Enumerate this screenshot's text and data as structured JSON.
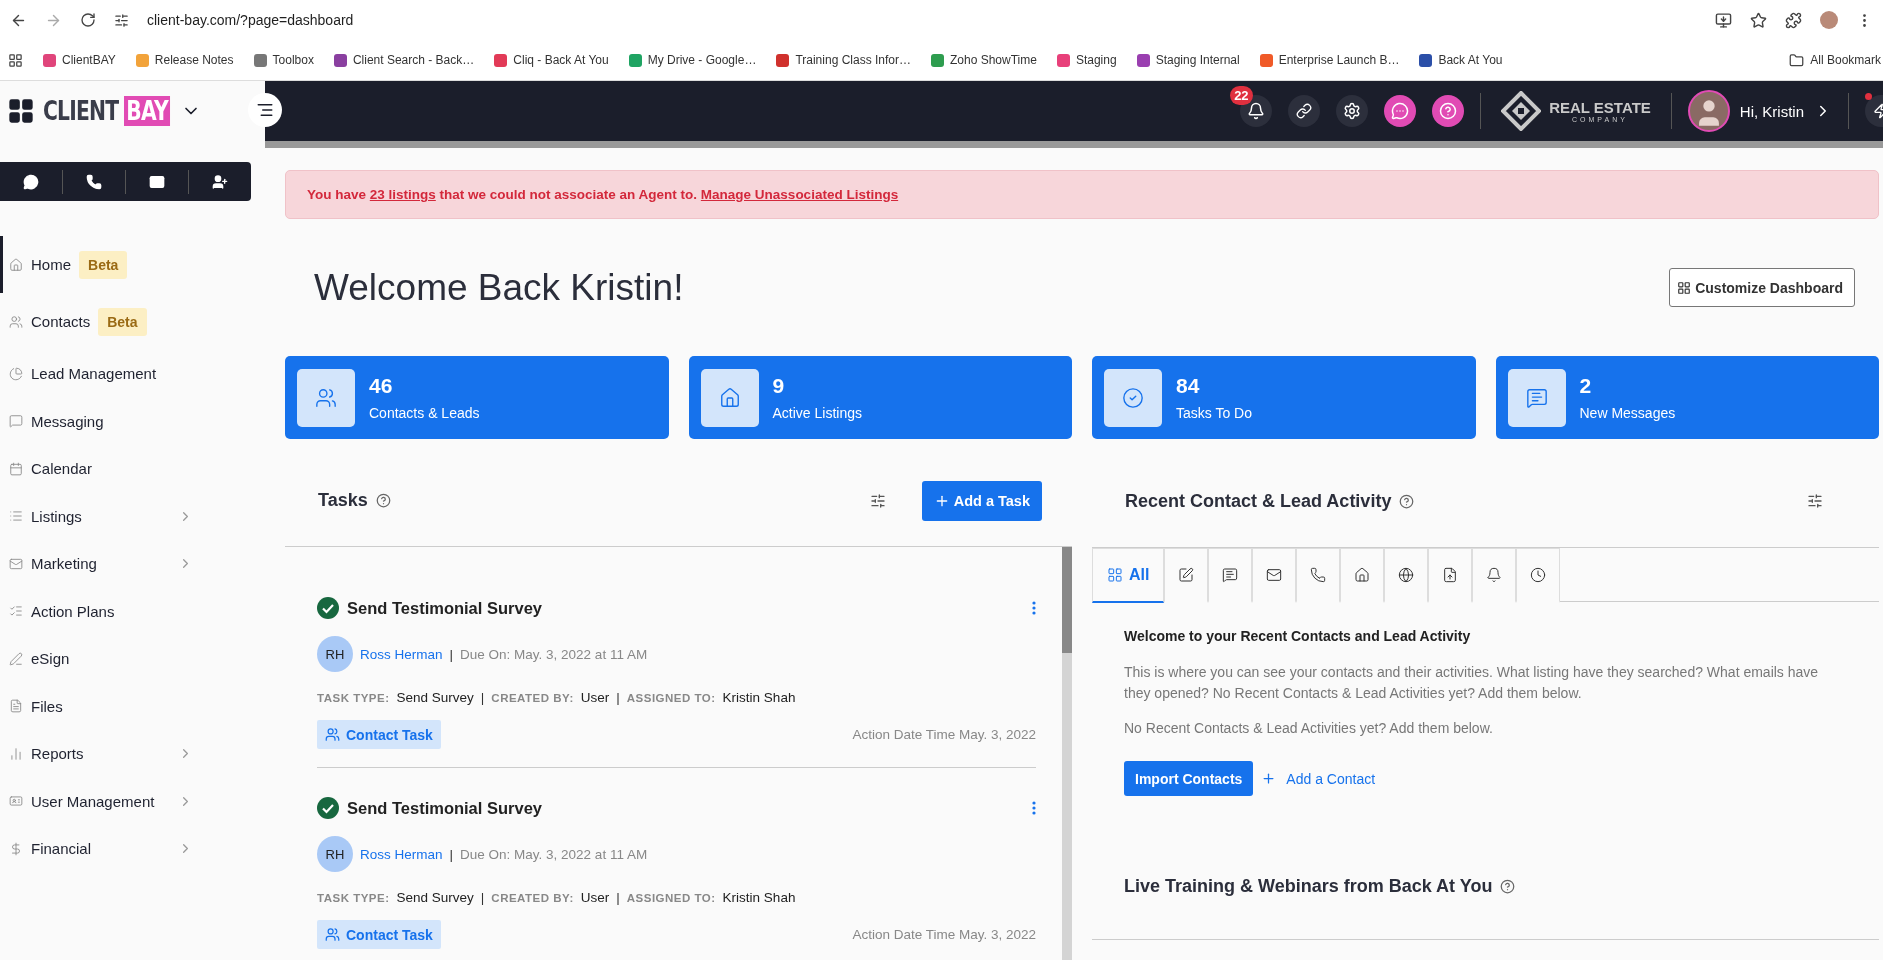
{
  "browser": {
    "url": "client-bay.com/?page=dashboard",
    "all_bookmarks": "All Bookmark",
    "bookmarks": [
      {
        "label": "ClientBAY",
        "color": "#e0457b"
      },
      {
        "label": "Release Notes",
        "color": "#f2a33a"
      },
      {
        "label": "Toolbox",
        "color": "#777777"
      },
      {
        "label": "Client Search - Back…",
        "color": "#8a3fa0"
      },
      {
        "label": "Cliq - Back At You",
        "color": "#e23a57"
      },
      {
        "label": "My Drive - Google…",
        "color": "#1fa463"
      },
      {
        "label": "Training Class Infor…",
        "color": "#d0312d"
      },
      {
        "label": "Zoho ShowTime",
        "color": "#2e9d4f"
      },
      {
        "label": "Staging",
        "color": "#e8407a"
      },
      {
        "label": "Staging Internal",
        "color": "#9a3fb0"
      },
      {
        "label": "Enterprise Launch B…",
        "color": "#f05a28"
      },
      {
        "label": "Back At You",
        "color": "#2b4fa8"
      }
    ]
  },
  "sidebar": {
    "logo_left": "CLIENT",
    "logo_right": "BAY",
    "items": [
      {
        "label": "Home",
        "badge": "Beta",
        "selected": true,
        "has_submenu": false
      },
      {
        "label": "Contacts",
        "badge": "Beta",
        "selected": false,
        "has_submenu": false
      },
      {
        "label": "Lead Management",
        "selected": false,
        "has_submenu": false
      },
      {
        "label": "Messaging",
        "selected": false,
        "has_submenu": false
      },
      {
        "label": "Calendar",
        "selected": false,
        "has_submenu": false
      },
      {
        "label": "Listings",
        "selected": false,
        "has_submenu": true
      },
      {
        "label": "Marketing",
        "selected": false,
        "has_submenu": true
      },
      {
        "label": "Action Plans",
        "selected": false,
        "has_submenu": false
      },
      {
        "label": "eSign",
        "selected": false,
        "has_submenu": false
      },
      {
        "label": "Files",
        "selected": false,
        "has_submenu": false
      },
      {
        "label": "Reports",
        "selected": false,
        "has_submenu": true
      },
      {
        "label": "User Management",
        "selected": false,
        "has_submenu": true
      },
      {
        "label": "Financial",
        "selected": false,
        "has_submenu": true
      }
    ]
  },
  "header": {
    "notification_count": "22",
    "brand_name": "REAL ESTATE",
    "brand_sub": "COMPANY",
    "greeting": "Hi, Kristin"
  },
  "alert": {
    "parts": [
      {
        "kind": "text",
        "text": "You have "
      },
      {
        "kind": "link",
        "text": "23 listings"
      },
      {
        "kind": "text",
        "text": " that we could not associate an Agent to. "
      },
      {
        "kind": "link",
        "text": "Manage Unassociated Listings"
      }
    ]
  },
  "welcome": {
    "title": "Welcome Back Kristin!",
    "customize_button": "Customize Dashboard"
  },
  "stats": [
    {
      "kind": "contacts",
      "value": "46",
      "label": "Contacts & Leads"
    },
    {
      "kind": "listings",
      "value": "9",
      "label": "Active Listings"
    },
    {
      "kind": "tasks",
      "value": "84",
      "label": "Tasks To Do"
    },
    {
      "kind": "messages",
      "value": "2",
      "label": "New Messages"
    }
  ],
  "tasks": {
    "title": "Tasks",
    "add_button": "Add a Task",
    "separator": "|",
    "items": [
      {
        "title": "Send Testimonial Survey",
        "completed": true,
        "initials": "RH",
        "contact": "Ross Herman",
        "due": "Due On: May. 3, 2022 at 11 AM",
        "meta": [
          {
            "label": "TASK TYPE:",
            "value": "Send Survey"
          },
          {
            "label": "CREATED BY:",
            "value": "User"
          },
          {
            "label": "ASSIGNED TO:",
            "value": "Kristin Shah"
          }
        ],
        "tag": "Contact Task",
        "action_date": "Action Date Time May. 3, 2022"
      },
      {
        "title": "Send Testimonial Survey",
        "completed": true,
        "initials": "RH",
        "contact": "Ross Herman",
        "due": "Due On: May. 3, 2022 at 11 AM",
        "meta": [
          {
            "label": "TASK TYPE:",
            "value": "Send Survey"
          },
          {
            "label": "CREATED BY:",
            "value": "User"
          },
          {
            "label": "ASSIGNED TO:",
            "value": "Kristin Shah"
          }
        ],
        "tag": "Contact Task",
        "action_date": "Action Date Time May. 3, 2022"
      }
    ]
  },
  "activity": {
    "title": "Recent Contact & Lead Activity",
    "tabs": [
      {
        "kind": "all",
        "label": "All",
        "selected": true
      },
      {
        "kind": "note",
        "selected": false
      },
      {
        "kind": "sms",
        "selected": false
      },
      {
        "kind": "email",
        "selected": false
      },
      {
        "kind": "call",
        "selected": false
      },
      {
        "kind": "listing",
        "selected": false
      },
      {
        "kind": "web",
        "selected": false
      },
      {
        "kind": "file",
        "selected": false
      },
      {
        "kind": "alert",
        "selected": false
      },
      {
        "kind": "history",
        "selected": false
      }
    ],
    "heading": "Welcome to your Recent Contacts and Lead Activity",
    "paragraphs": [
      "This is where you can see your contacts and their activities. What listing have they searched? What emails have they opened? No Recent Contacts & Lead Activities yet? Add them below.",
      "No Recent Contacts & Lead Activities yet? Add them below."
    ],
    "import_button": "Import Contacts",
    "add_link": "Add a Contact"
  },
  "training": {
    "title": "Live Training & Webinars from Back At You"
  }
}
